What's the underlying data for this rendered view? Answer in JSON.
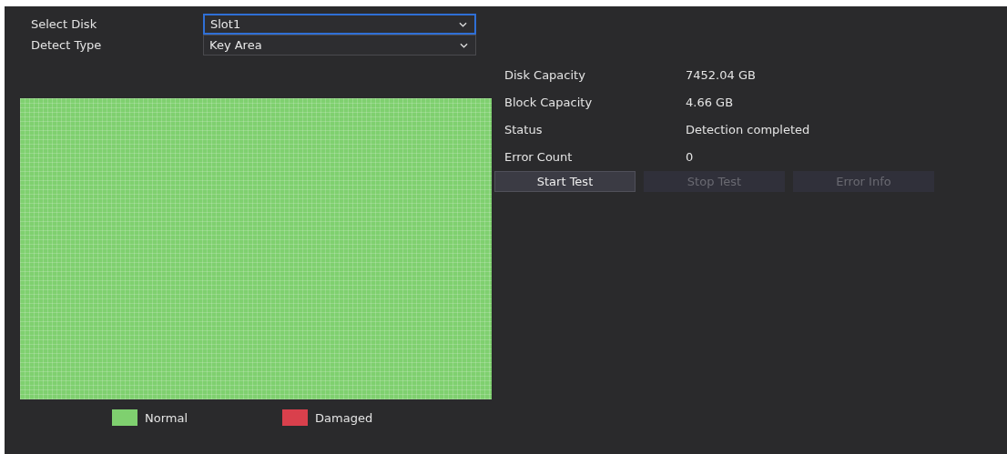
{
  "fields": [
    {
      "label": "Select Disk",
      "value": "Slot1",
      "focused": true
    },
    {
      "label": "Detect Type",
      "value": "Key Area",
      "focused": false
    }
  ],
  "info": [
    {
      "label": "Disk Capacity",
      "value": "7452.04 GB"
    },
    {
      "label": "Block Capacity",
      "value": "4.66 GB"
    },
    {
      "label": "Status",
      "value": "Detection completed"
    },
    {
      "label": "Error Count",
      "value": "0"
    }
  ],
  "buttons": [
    {
      "label": "Start Test",
      "disabled": false
    },
    {
      "label": "Stop Test",
      "disabled": true
    },
    {
      "label": "Error Info",
      "disabled": true
    }
  ],
  "legend": [
    {
      "label": "Normal",
      "color": "#7fd06f"
    },
    {
      "label": "Damaged",
      "color": "#d9404c"
    }
  ]
}
